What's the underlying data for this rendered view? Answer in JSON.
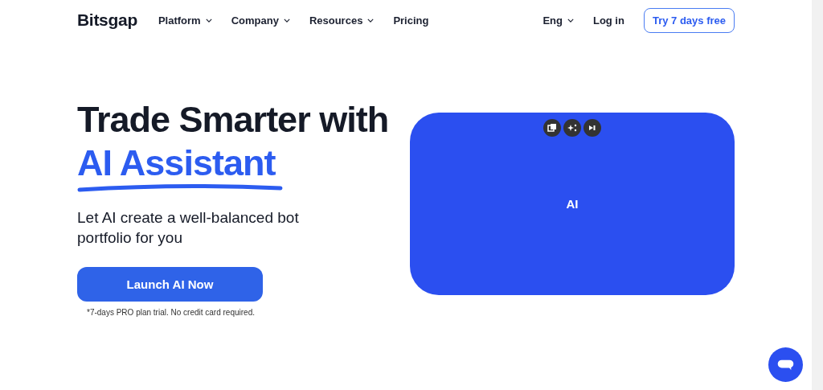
{
  "header": {
    "logo": "Bitsgap",
    "nav": [
      {
        "label": "Platform",
        "dropdown": true
      },
      {
        "label": "Company",
        "dropdown": true
      },
      {
        "label": "Resources",
        "dropdown": true
      },
      {
        "label": "Pricing",
        "dropdown": false
      }
    ],
    "language": "Eng",
    "login": "Log in",
    "trial_button": "Try 7 days free"
  },
  "hero": {
    "title_line": "Trade Smarter with",
    "title_highlight": "AI Assistant",
    "subtitle": "Let AI create a well-balanced bot portfolio for you",
    "cta": "Launch AI Now",
    "note": "*7-days PRO plan trial. No credit card required.",
    "video": {
      "label": "AI"
    }
  }
}
